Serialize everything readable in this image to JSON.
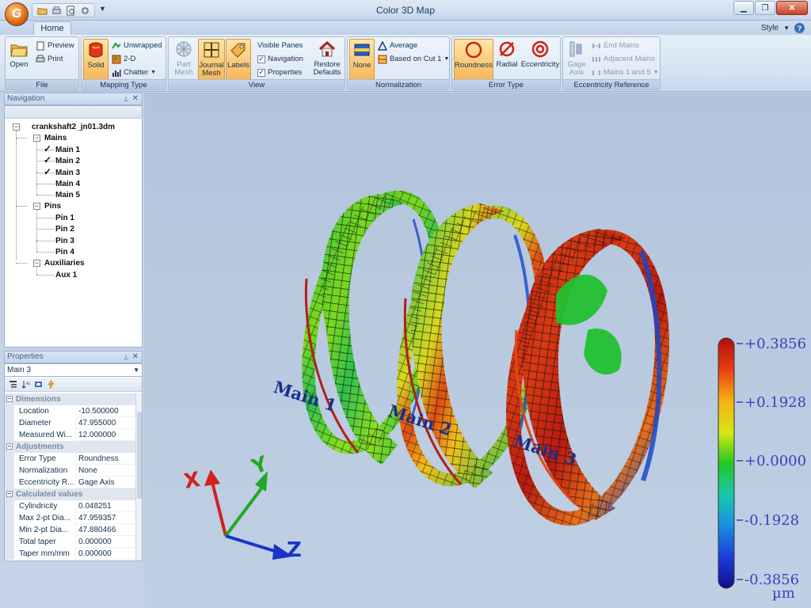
{
  "window": {
    "title": "Color 3D Map",
    "app_initial": "G"
  },
  "tabs": [
    {
      "label": "Home"
    }
  ],
  "style_menu": {
    "label": "Style",
    "help": "?"
  },
  "ribbon": {
    "file": {
      "label": "File",
      "open": "Open",
      "preview": "Preview",
      "print": "Print"
    },
    "mapping_type": {
      "label": "Mapping Type",
      "solid": "Solid",
      "unwrapped": "Unwrapped",
      "two_d": "2-D",
      "chatter": "Chatter"
    },
    "view": {
      "label": "View",
      "part_mesh": [
        "Part",
        "Mesh"
      ],
      "journal_mesh": [
        "Journal",
        "Mesh"
      ],
      "labels": "Labels",
      "visible_panes": "Visible Panes",
      "navigation": "Navigation",
      "properties": "Properties",
      "restore_defaults": [
        "Restore",
        "Defaults"
      ]
    },
    "normalization": {
      "label": "Normalization",
      "none": "None",
      "average": "Average",
      "based_on_cut": "Based on Cut 1"
    },
    "error_type": {
      "label": "Error Type",
      "roundness": "Roundness",
      "radial": "Radial",
      "eccentricity": "Eccentricity"
    },
    "eccentricity_ref": {
      "label": "Eccentricity Reference",
      "gage_axis": [
        "Gage",
        "Axis"
      ],
      "end_mains": "End Mains",
      "adjacent_mains": "Adjacent Mains",
      "mains_1_5": "Mains 1 and 5"
    }
  },
  "navigation": {
    "title": "Navigation",
    "root": "crankshaft2_jn01.3dm",
    "groups": [
      {
        "label": "Mains",
        "items": [
          "Main 1",
          "Main 2",
          "Main 3",
          "Main 4",
          "Main 5"
        ],
        "checked": [
          true,
          true,
          true,
          false,
          false
        ]
      },
      {
        "label": "Pins",
        "items": [
          "Pin 1",
          "Pin 2",
          "Pin 3",
          "Pin 4"
        ]
      },
      {
        "label": "Auxiliaries",
        "items": [
          "Aux 1"
        ]
      }
    ],
    "check_mark": "✓",
    "toggle_minus": "−"
  },
  "properties": {
    "title": "Properties",
    "selected": "Main 3",
    "categories": [
      {
        "name": "Dimensions",
        "rows": [
          [
            "Location",
            "-10.500000"
          ],
          [
            "Diameter",
            "47.955000"
          ],
          [
            "Measured Wi...",
            "12.000000"
          ]
        ]
      },
      {
        "name": "Adjustments",
        "rows": [
          [
            "Error Type",
            "Roundness"
          ],
          [
            "Normalization",
            "None"
          ],
          [
            "Eccentricity R...",
            "Gage Axis"
          ]
        ]
      },
      {
        "name": "Calculated values",
        "rows": [
          [
            "Cylindricity",
            "0.048251"
          ],
          [
            "Max 2-pt Dia...",
            "47.959357"
          ],
          [
            "Min 2-pt Dia...",
            "47.880466"
          ],
          [
            "Total taper",
            "0.000000"
          ],
          [
            "Taper mm/mm",
            "0.000000"
          ]
        ]
      }
    ]
  },
  "scene": {
    "main_labels": [
      "Main 1",
      "Main 2",
      "Main 3"
    ],
    "axes": {
      "x": "X",
      "y": "Y",
      "z": "Z"
    },
    "legend": {
      "ticks": [
        "+0.3856",
        "+0.1928",
        "+0.0000",
        "-0.1928",
        "-0.3856"
      ],
      "unit": "µm"
    }
  },
  "colors": {
    "accent": "#f8b85a",
    "x_axis": "#d42020",
    "y_axis": "#22a822",
    "z_axis": "#1a34c8"
  }
}
